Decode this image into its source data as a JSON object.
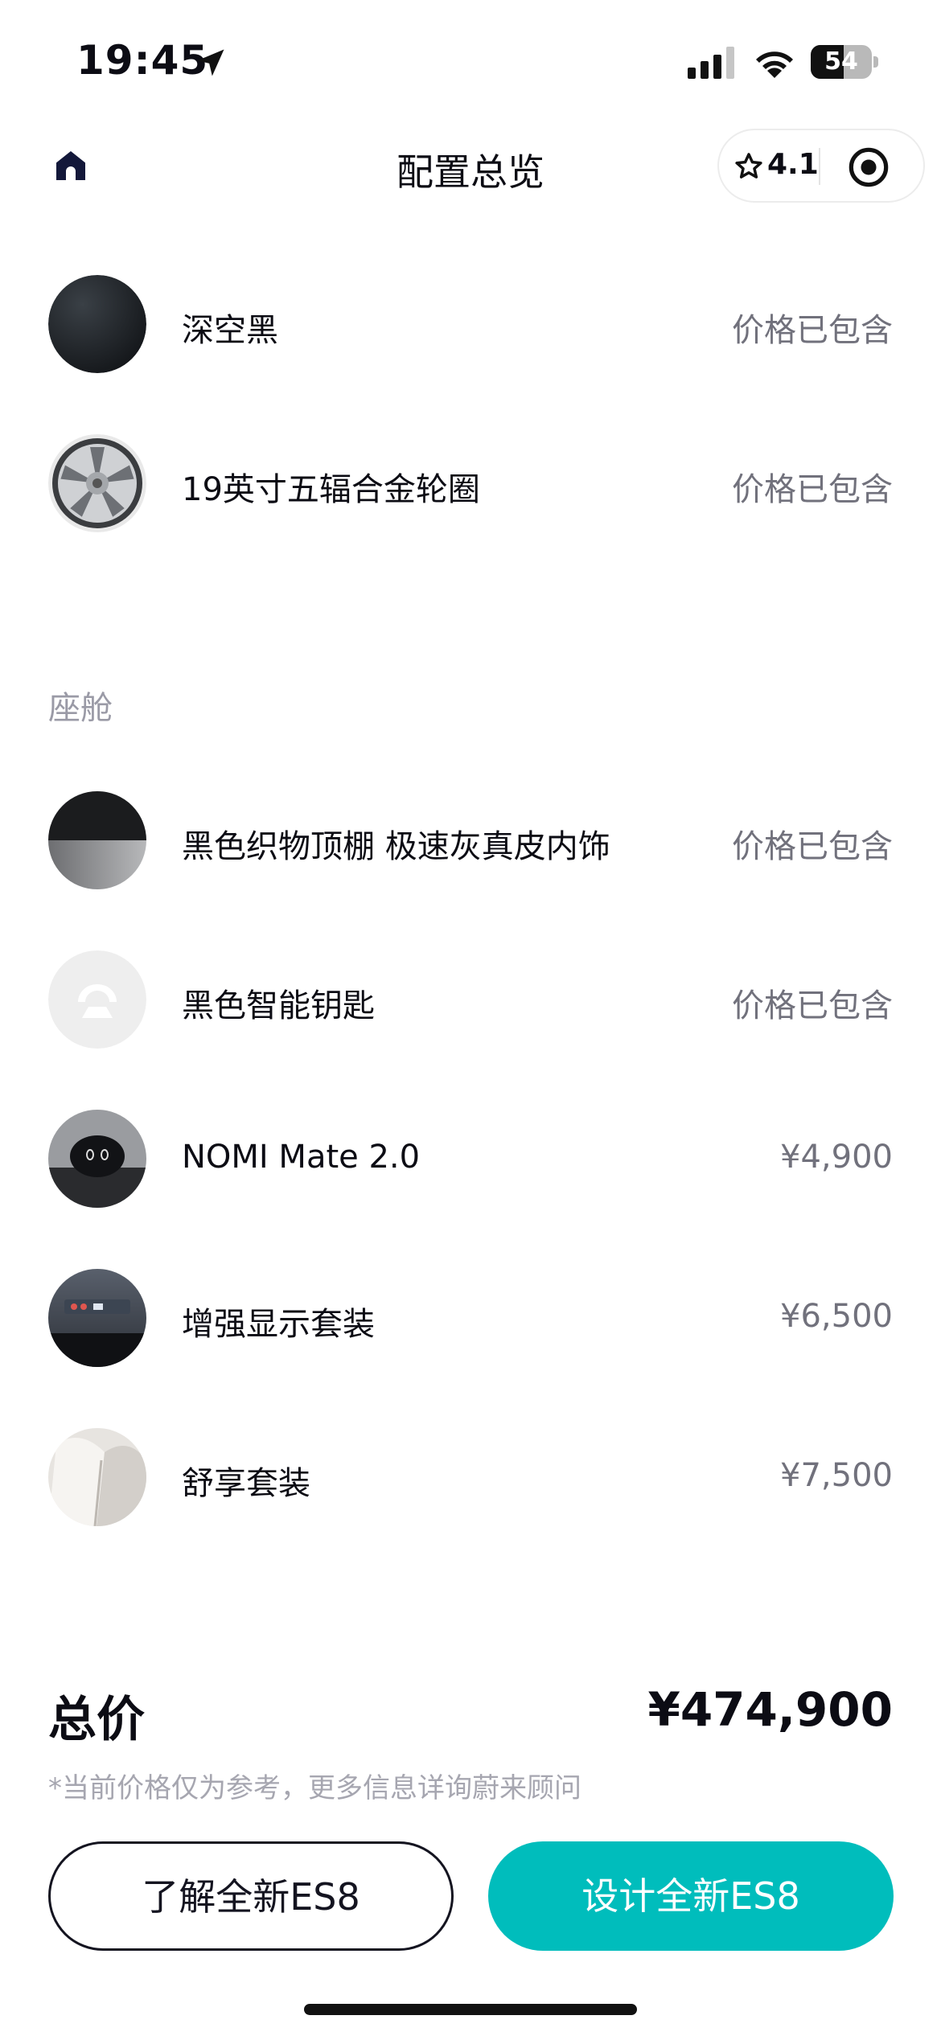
{
  "status_bar": {
    "time": "19:45",
    "battery": "54",
    "battery_level": 0.54
  },
  "nav": {
    "title": "配置总览",
    "rating": "4.1"
  },
  "items_top": [
    {
      "name": "深空黑",
      "price": "价格已包含",
      "thumb": "dark-paint-swatch"
    },
    {
      "name": "19英寸五辐合金轮圈",
      "price": "价格已包含",
      "thumb": "alloy-wheel"
    }
  ],
  "section_cabin": "座舱",
  "items_cabin": [
    {
      "name": "黑色织物顶棚 极速灰真皮内饰",
      "price": "价格已包含",
      "thumb": "interior-swatch"
    },
    {
      "name": "黑色智能钥匙",
      "price": "价格已包含",
      "thumb": "nio-logo-key"
    },
    {
      "name": "NOMI Mate 2.0",
      "price": "¥4,900",
      "thumb": "nomi-device"
    },
    {
      "name": "增强显示套装",
      "price": "¥6,500",
      "thumb": "hud-display"
    },
    {
      "name": "舒享套装",
      "price": "¥7,500",
      "thumb": "seat-comfort"
    }
  ],
  "summary": {
    "total_label": "总价",
    "total_value": "¥474,900",
    "note": "*当前价格仅为参考，更多信息详询蔚来顾问"
  },
  "actions": {
    "learn_label": "了解全新ES8",
    "design_label": "设计全新ES8"
  },
  "colors": {
    "accent": "#00bdbc",
    "text": "#0c0c14",
    "muted": "#71717c"
  }
}
